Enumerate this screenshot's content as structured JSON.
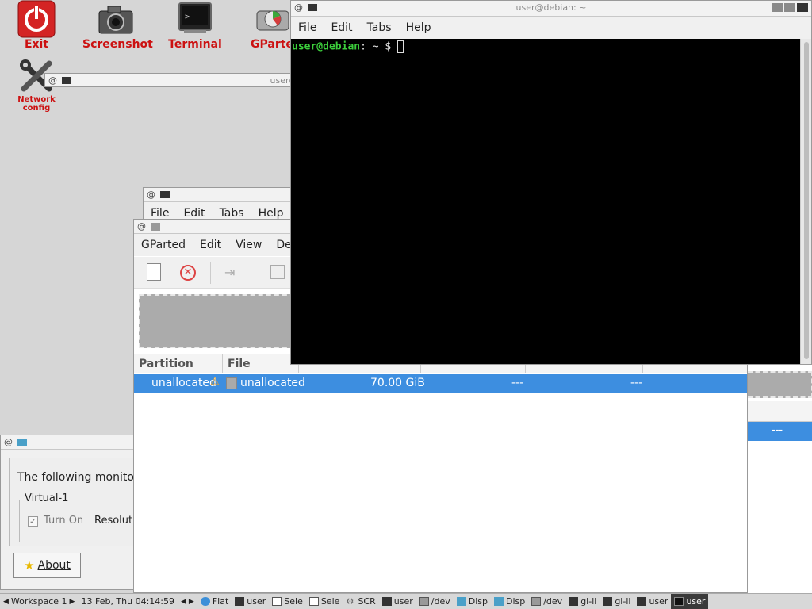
{
  "desktop": {
    "icons": [
      {
        "label": "Exit"
      },
      {
        "label": "Screenshot"
      },
      {
        "label": "Terminal"
      },
      {
        "label": "GParted"
      },
      {
        "label": "Network config"
      }
    ]
  },
  "terminal_main": {
    "title": "user@debian: ~",
    "menu": [
      "File",
      "Edit",
      "Tabs",
      "Help"
    ],
    "prompt_user": "user@debian",
    "prompt_rest": ": ~ $ "
  },
  "terminal_back": {
    "title": "user@debian: ~"
  },
  "terminal_mid": {
    "menu": [
      "File",
      "Edit",
      "Tabs",
      "Help"
    ]
  },
  "gparted": {
    "menu": [
      "GParted",
      "Edit",
      "View",
      "Device"
    ],
    "columns": [
      "Partition",
      "File System"
    ],
    "row": {
      "partition": "unallocated",
      "filesystem": "unallocated",
      "size": "70.00 GiB",
      "used": "---",
      "unused": "---"
    },
    "right_row_value": "---"
  },
  "monitor_dialog": {
    "text": "The following monitor is",
    "group": "Virtual-1",
    "turn_on": "Turn On",
    "resolution": "Resoluti",
    "about": "About"
  },
  "taskbar": {
    "workspace": "Workspace 1",
    "datetime": "13 Feb, Thu 04:14:59",
    "items": [
      "Flat",
      "user",
      "Sele",
      "Sele",
      "SCR",
      "user",
      "/dev",
      "Disp",
      "Disp",
      "/dev",
      "gl-li",
      "gl-li",
      "user",
      "user"
    ]
  }
}
